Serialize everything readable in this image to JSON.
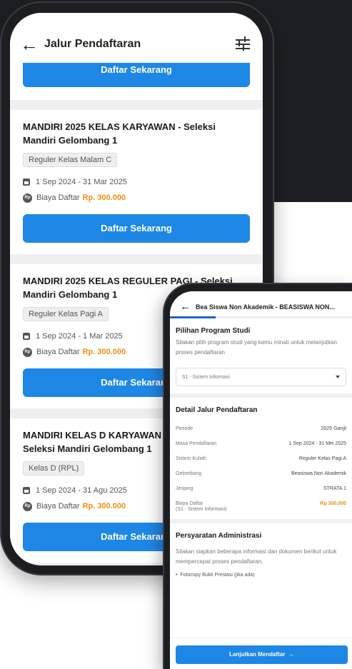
{
  "colors": {
    "primary": "#1e87e5",
    "price": "#f28b16",
    "dark": "#1e1f24"
  },
  "phone1": {
    "header": {
      "title": "Jalur Pendaftaran",
      "back_icon": "arrow-left-icon",
      "filter_icon": "filter-sliders-icon"
    },
    "top_button": "Daftar Sekarang",
    "cards": [
      {
        "title": "MANDIRI 2025 KELAS KARYAWAN - Seleksi Mandiri Gelombang 1",
        "chip": "Reguler Kelas Malam C",
        "date": "1 Sep 2024 - 31 Mar 2025",
        "fee_label": "Biaya Daftar",
        "fee": "Rp. 300.000",
        "button": "Daftar Sekarang"
      },
      {
        "title": "MANDIRI 2025 KELAS REGULER PAGI - Seleksi Mandiri Gelombang 1",
        "chip": "Reguler Kelas Pagi A",
        "date": "1 Sep 2024 - 1 Mar 2025",
        "fee_label": "Biaya Daftar",
        "fee": "Rp. 300.000",
        "button": "Daftar Sekarang"
      },
      {
        "title": "MANDIRI KELAS D KARYAWAN LANJUTAN - Seleksi Mandiri Gelombang 1",
        "chip": "Kelas D (RPL)",
        "date": "1 Sep 2024 - 31 Agu 2025",
        "fee_label": "Biaya Daftar",
        "fee": "Rp. 300.000",
        "button": "Daftar Sekarang"
      }
    ]
  },
  "phone2": {
    "header": {
      "title": "Bea Siswa Non Akademik - BEASISWA NON..."
    },
    "program": {
      "heading": "Pilihan Program Studi",
      "desc": "Silakan pilih program studi yang kamu minati untuk melanjutkan proses pendaftaran",
      "selected": "S1 - Sistem Informasi"
    },
    "detail": {
      "heading": "Detail Jalur Pendaftaran",
      "rows": [
        {
          "label": "Periode",
          "value": "2025 Ganjil"
        },
        {
          "label": "Masa Pendaftaran",
          "value": "1 Sep 2024 - 31 Mei 2025"
        },
        {
          "label": "Sistem Kuliah",
          "value": "Reguler Kelas Pagi A"
        },
        {
          "label": "Gelombang",
          "value": "Beasiswa Non Akademik"
        },
        {
          "label": "Jenjang",
          "value": "STRATA 1"
        },
        {
          "label": "Biaya Daftar",
          "value": "Rp 300.000"
        }
      ],
      "fee_note": "(S1 - Sistem Informasi)"
    },
    "requirements": {
      "heading": "Persyaratan Administrasi",
      "desc": "Silakan siapkan beberapa informasi dan dokumen berikut untuk mempercepat proses pendaftaran.",
      "items": [
        "Fotocopy Bukti Prestasi (jika ada)"
      ]
    },
    "continue_button": "Lanjutkan Mendaftar"
  }
}
